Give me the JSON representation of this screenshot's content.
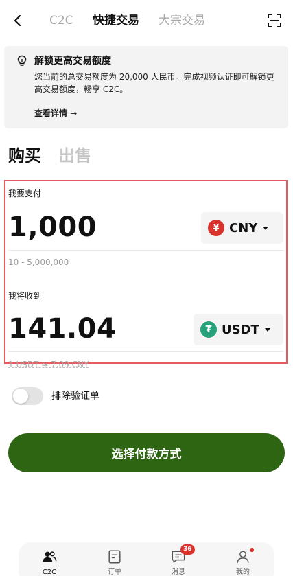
{
  "header": {
    "tabs": [
      {
        "label": "C2C",
        "active": false
      },
      {
        "label": "快捷交易",
        "active": true
      },
      {
        "label": "大宗交易",
        "active": false
      }
    ],
    "icons": {
      "back": "back-arrow-icon",
      "scan": "scan-icon"
    }
  },
  "banner": {
    "icon": "lightbulb-icon",
    "title": "解锁更高交易额度",
    "body": "您当前的总交易额度为 20,000 人民币。完成视频认证即可解锁更高交易额度，畅享 C2C。",
    "link": "查看详情 →"
  },
  "side": {
    "buy": "购买",
    "sell": "出售",
    "active": "buy"
  },
  "pay": {
    "label": "我要支付",
    "amount": "1,000",
    "currency": "CNY",
    "currency_symbol": "¥",
    "range": "10 - 5,000,000"
  },
  "receive": {
    "label": "我将收到",
    "amount": "141.04",
    "currency": "USDT",
    "currency_symbol": "₮",
    "rate": "1 USDT ≈ 7.09 CNY"
  },
  "toggle": {
    "label": "排除验证单",
    "on": false
  },
  "cta": {
    "label": "选择付款方式"
  },
  "nav": {
    "items": [
      {
        "label": "C2C",
        "icon": "users-icon",
        "active": true
      },
      {
        "label": "订单",
        "icon": "orders-icon",
        "active": false
      },
      {
        "label": "消息",
        "icon": "message-icon",
        "badge": "36",
        "active": false
      },
      {
        "label": "我的",
        "icon": "profile-icon",
        "active": false
      }
    ]
  },
  "colors": {
    "accent": "#2e6512",
    "cny": "#d9342c",
    "usdt": "#26a17b",
    "highlight_border": "#e65b60",
    "inactive_text": "#a8a8a8"
  }
}
